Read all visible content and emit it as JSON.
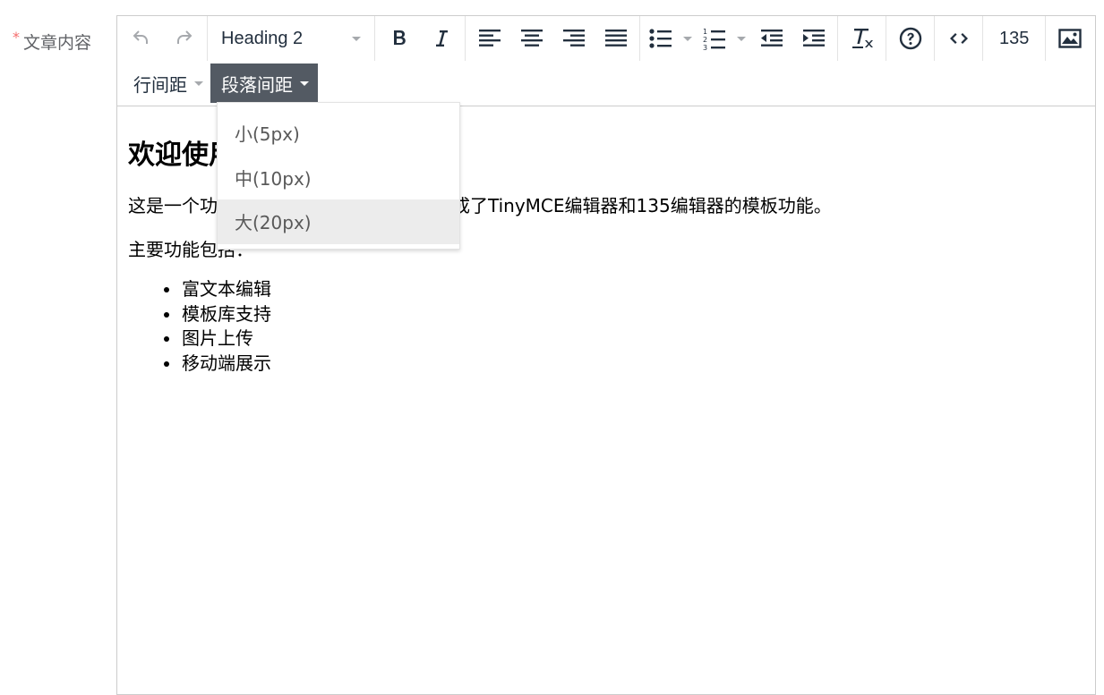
{
  "form": {
    "required_mark": "*",
    "label": "文章内容"
  },
  "toolbar": {
    "block_format": "Heading 2",
    "source_label": "135",
    "icons": [
      "undo-icon",
      "redo-icon",
      "bold-icon",
      "italic-icon",
      "align-left-icon",
      "align-center-icon",
      "align-right-icon",
      "align-justify-icon",
      "bullet-list-icon",
      "numbered-list-icon",
      "outdent-icon",
      "indent-icon",
      "remove-format-icon",
      "help-icon",
      "code-icon",
      "image-icon"
    ]
  },
  "menus": {
    "line_height": "行间距",
    "paragraph_spacing": "段落间距"
  },
  "dropdown": {
    "items": [
      "小(5px)",
      "中(10px)",
      "大(20px)"
    ],
    "hovered": "大(20px)"
  },
  "content": {
    "heading": "欢迎使用",
    "intro_visible": "这是一个功",
    "intro_rest": "成了TinyMCE编辑器和135编辑器的模板功能。",
    "features_label": "主要功能包括：",
    "features": [
      "富文本编辑",
      "模板库支持",
      "图片上传",
      "移动端展示"
    ]
  },
  "colors": {
    "required": "#f56c6c",
    "active_menu_bg": "#535a63",
    "hover_bg": "#ececec"
  }
}
